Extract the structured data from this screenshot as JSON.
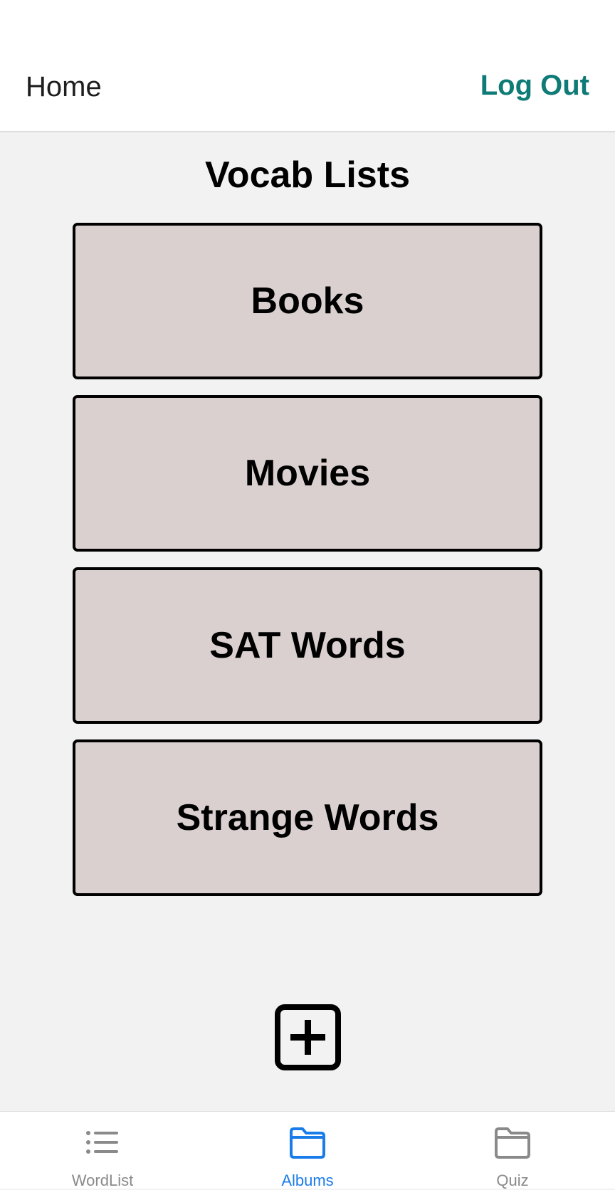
{
  "header": {
    "title": "Home",
    "logout_label": "Log Out"
  },
  "main": {
    "heading": "Vocab Lists",
    "lists": [
      {
        "label": "Books"
      },
      {
        "label": "Movies"
      },
      {
        "label": "SAT Words"
      },
      {
        "label": "Strange Words"
      }
    ],
    "add_icon": "plus-square-icon"
  },
  "tabs": [
    {
      "label": "WordList",
      "icon": "list-icon",
      "active": false
    },
    {
      "label": "Albums",
      "icon": "folder-icon",
      "active": true
    },
    {
      "label": "Quiz",
      "icon": "folder-icon",
      "active": false
    }
  ],
  "colors": {
    "accent": "#0f7b76",
    "active_tab": "#1a7ce8",
    "inactive_tab": "#8a8a8a",
    "card_background": "#dbd0d0",
    "page_background": "#f2f2f2"
  }
}
